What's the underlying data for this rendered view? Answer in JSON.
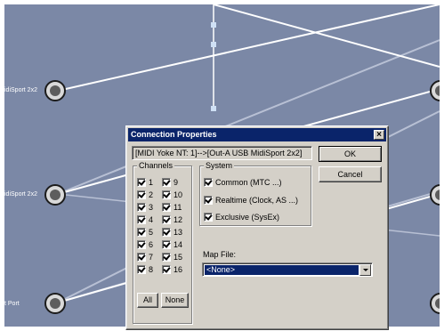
{
  "canvas": {
    "ports": [
      {
        "label": "idiSport 2x2"
      },
      {
        "label": "idiSport 2x2"
      },
      {
        "label": "t Port"
      }
    ]
  },
  "dialog": {
    "title": "Connection Properties",
    "connection_text": "[MIDI Yoke NT:  1]-->[Out-A USB MidiSport 2x2]",
    "ok_label": "OK",
    "cancel_label": "Cancel",
    "channels": {
      "legend": "Channels",
      "left": [
        {
          "label": "1",
          "checked": true
        },
        {
          "label": "2",
          "checked": true
        },
        {
          "label": "3",
          "checked": true
        },
        {
          "label": "4",
          "checked": true
        },
        {
          "label": "5",
          "checked": true
        },
        {
          "label": "6",
          "checked": true
        },
        {
          "label": "7",
          "checked": true
        },
        {
          "label": "8",
          "checked": true
        }
      ],
      "right": [
        {
          "label": "9",
          "checked": true
        },
        {
          "label": "10",
          "checked": true
        },
        {
          "label": "11",
          "checked": true
        },
        {
          "label": "12",
          "checked": true
        },
        {
          "label": "13",
          "checked": true
        },
        {
          "label": "14",
          "checked": true
        },
        {
          "label": "15",
          "checked": true
        },
        {
          "label": "16",
          "checked": true
        }
      ],
      "all_label": "All",
      "none_label": "None"
    },
    "system": {
      "legend": "System",
      "items": [
        {
          "label": "Common (MTC ...)",
          "checked": true
        },
        {
          "label": "Realtime (Clock, AS ...)",
          "checked": true
        },
        {
          "label": "Exclusive (SysEx)",
          "checked": true
        }
      ]
    },
    "map_file": {
      "label": "Map File:",
      "value": "<None>"
    }
  },
  "colors": {
    "canvas_bg": "#7b88a6",
    "titlebar": "#0a246a",
    "dialog_face": "#d4d0c8"
  }
}
